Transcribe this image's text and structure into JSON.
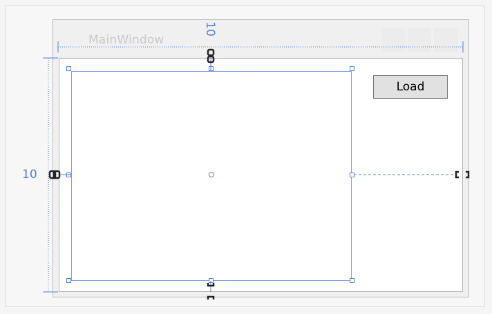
{
  "window": {
    "title": "MainWindow"
  },
  "toolbar": {
    "load_label": "Load"
  },
  "margins": {
    "top_label": "10",
    "left_label": "10"
  },
  "colors": {
    "selection": "#4a7fd8",
    "surface": "#f5f5f5",
    "client": "#ffffff",
    "button": "#e1e1e1"
  },
  "icons": {
    "anchor": "chain-link-icon",
    "center": "center-point-icon"
  }
}
